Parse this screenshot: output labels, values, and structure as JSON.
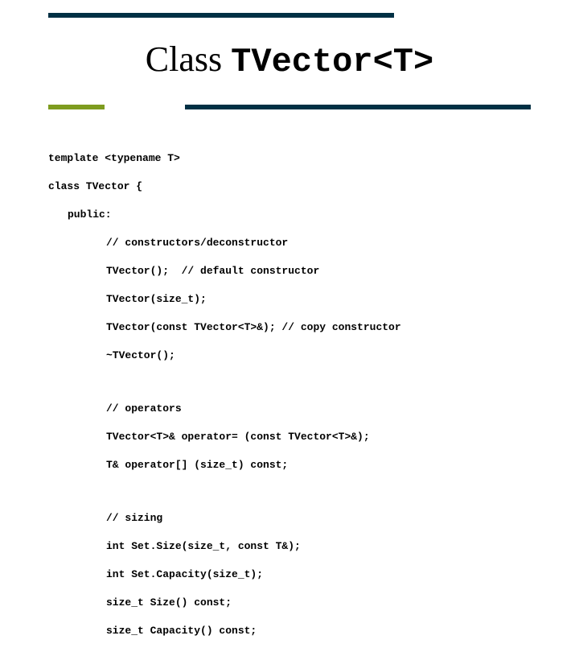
{
  "title": {
    "serif": "Class ",
    "mono": "TVector<T>"
  },
  "code": {
    "l01": "template <typename T>",
    "l02": "class TVector {",
    "l03": "public:",
    "l04": "// constructors/deconstructor",
    "l05": "TVector();  // default constructor",
    "l06": "TVector(size_t);",
    "l07": "TVector(const TVector<T>&); // copy constructor",
    "l08": "~TVector();",
    "l09": "// operators",
    "l10": "TVector<T>& operator= (const TVector<T>&);",
    "l11": "T& operator[] (size_t) const;",
    "l12": "// sizing",
    "l13": "int Set.Size(size_t, const T&);",
    "l14": "int Set.Capacity(size_t);",
    "l15": "size_t Size() const;",
    "l16": "size_t Capacity() const;"
  }
}
